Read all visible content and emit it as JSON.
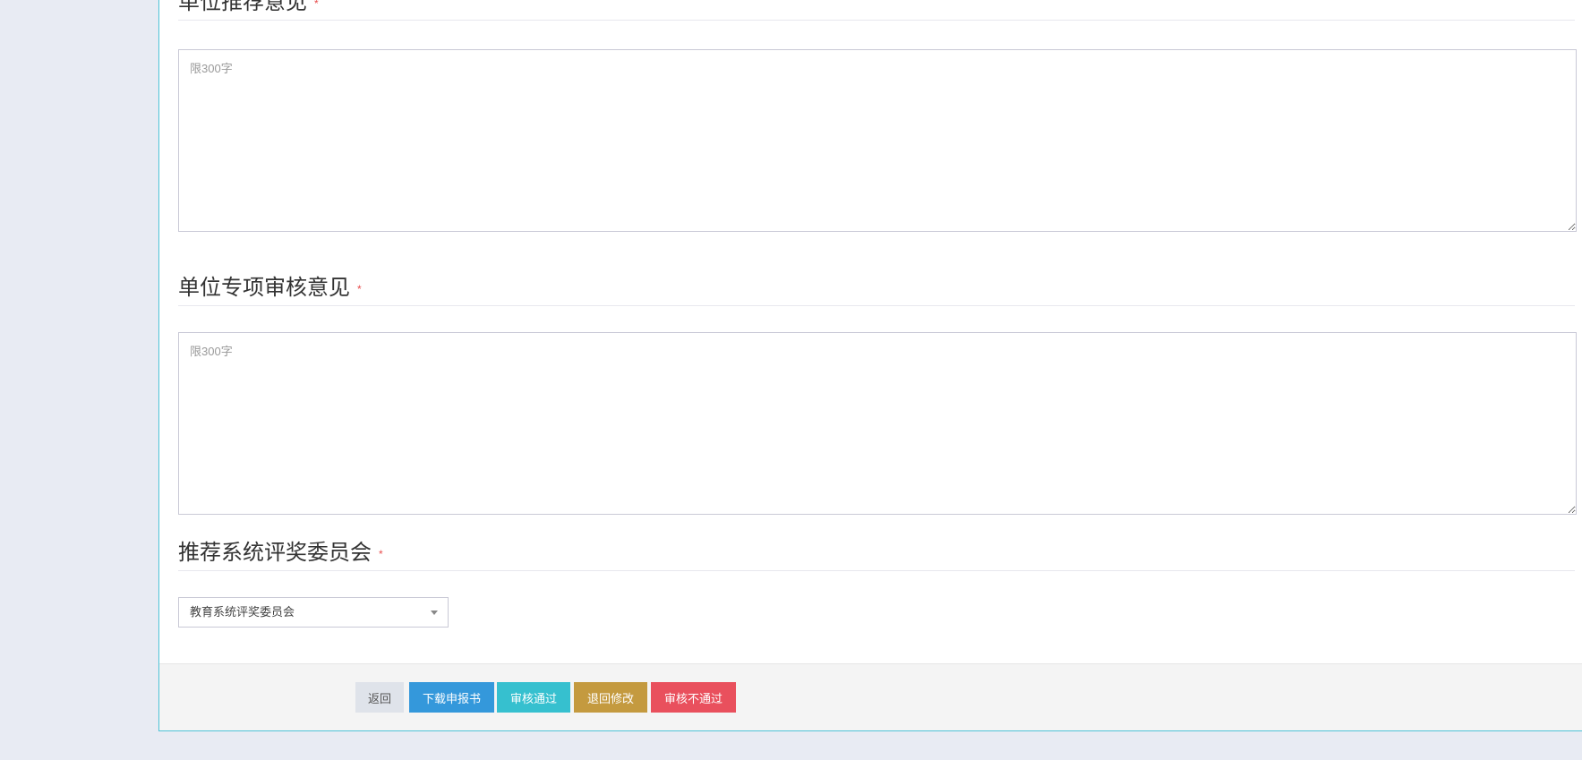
{
  "sections": {
    "recommend": {
      "title": "单位推荐意见",
      "required_mark": "*",
      "placeholder": "限300字",
      "value": ""
    },
    "special_review": {
      "title": "单位专项审核意见",
      "required_mark": "*",
      "placeholder": "限300字",
      "value": ""
    },
    "committee": {
      "title": "推荐系统评奖委员会",
      "required_mark": "*",
      "selected": "教育系统评奖委员会"
    }
  },
  "footer": {
    "back_label": "返回",
    "download_label": "下载申报书",
    "approve_label": "审核通过",
    "return_label": "退回修改",
    "reject_label": "审核不通过"
  },
  "colors": {
    "accent_border": "#4fc3d7",
    "download": "#3498db",
    "approve": "#36c0cf",
    "return": "#c49a3f",
    "reject": "#e9505d",
    "back": "#dfe3ea",
    "required": "#e84c4c"
  }
}
